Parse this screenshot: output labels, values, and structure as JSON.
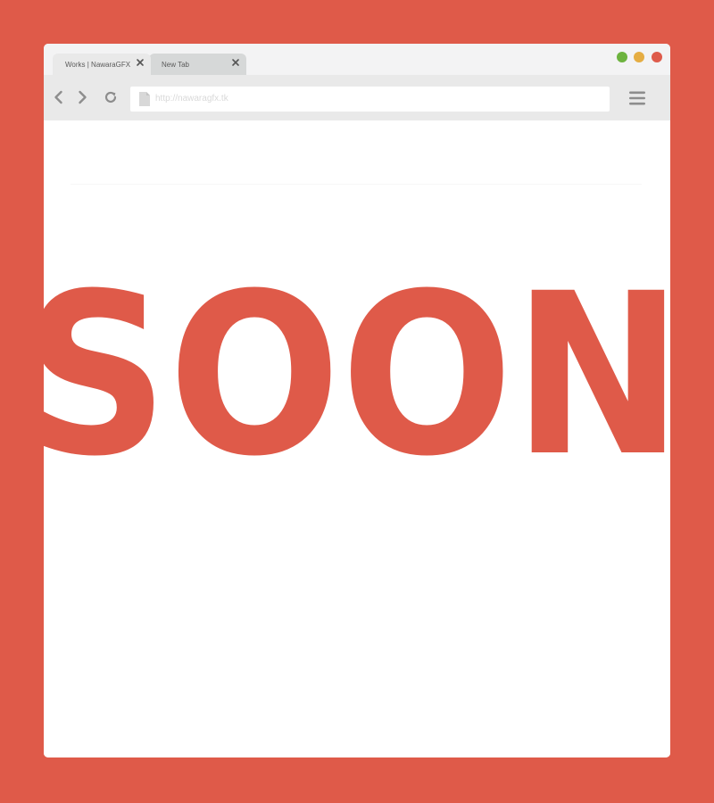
{
  "browser": {
    "tabs": [
      {
        "label": "Works | NawaraGFX",
        "active": true
      },
      {
        "label": "New Tab",
        "active": false
      }
    ],
    "address_bar": {
      "url": "http://nawaragfx.tk"
    },
    "window_controls": {
      "colors": [
        "#6db33f",
        "#e5ad43",
        "#de5b4b"
      ]
    }
  },
  "page": {
    "headline": "SOON",
    "colors": {
      "accent": "#df5a49",
      "background": "#ffffff"
    }
  }
}
